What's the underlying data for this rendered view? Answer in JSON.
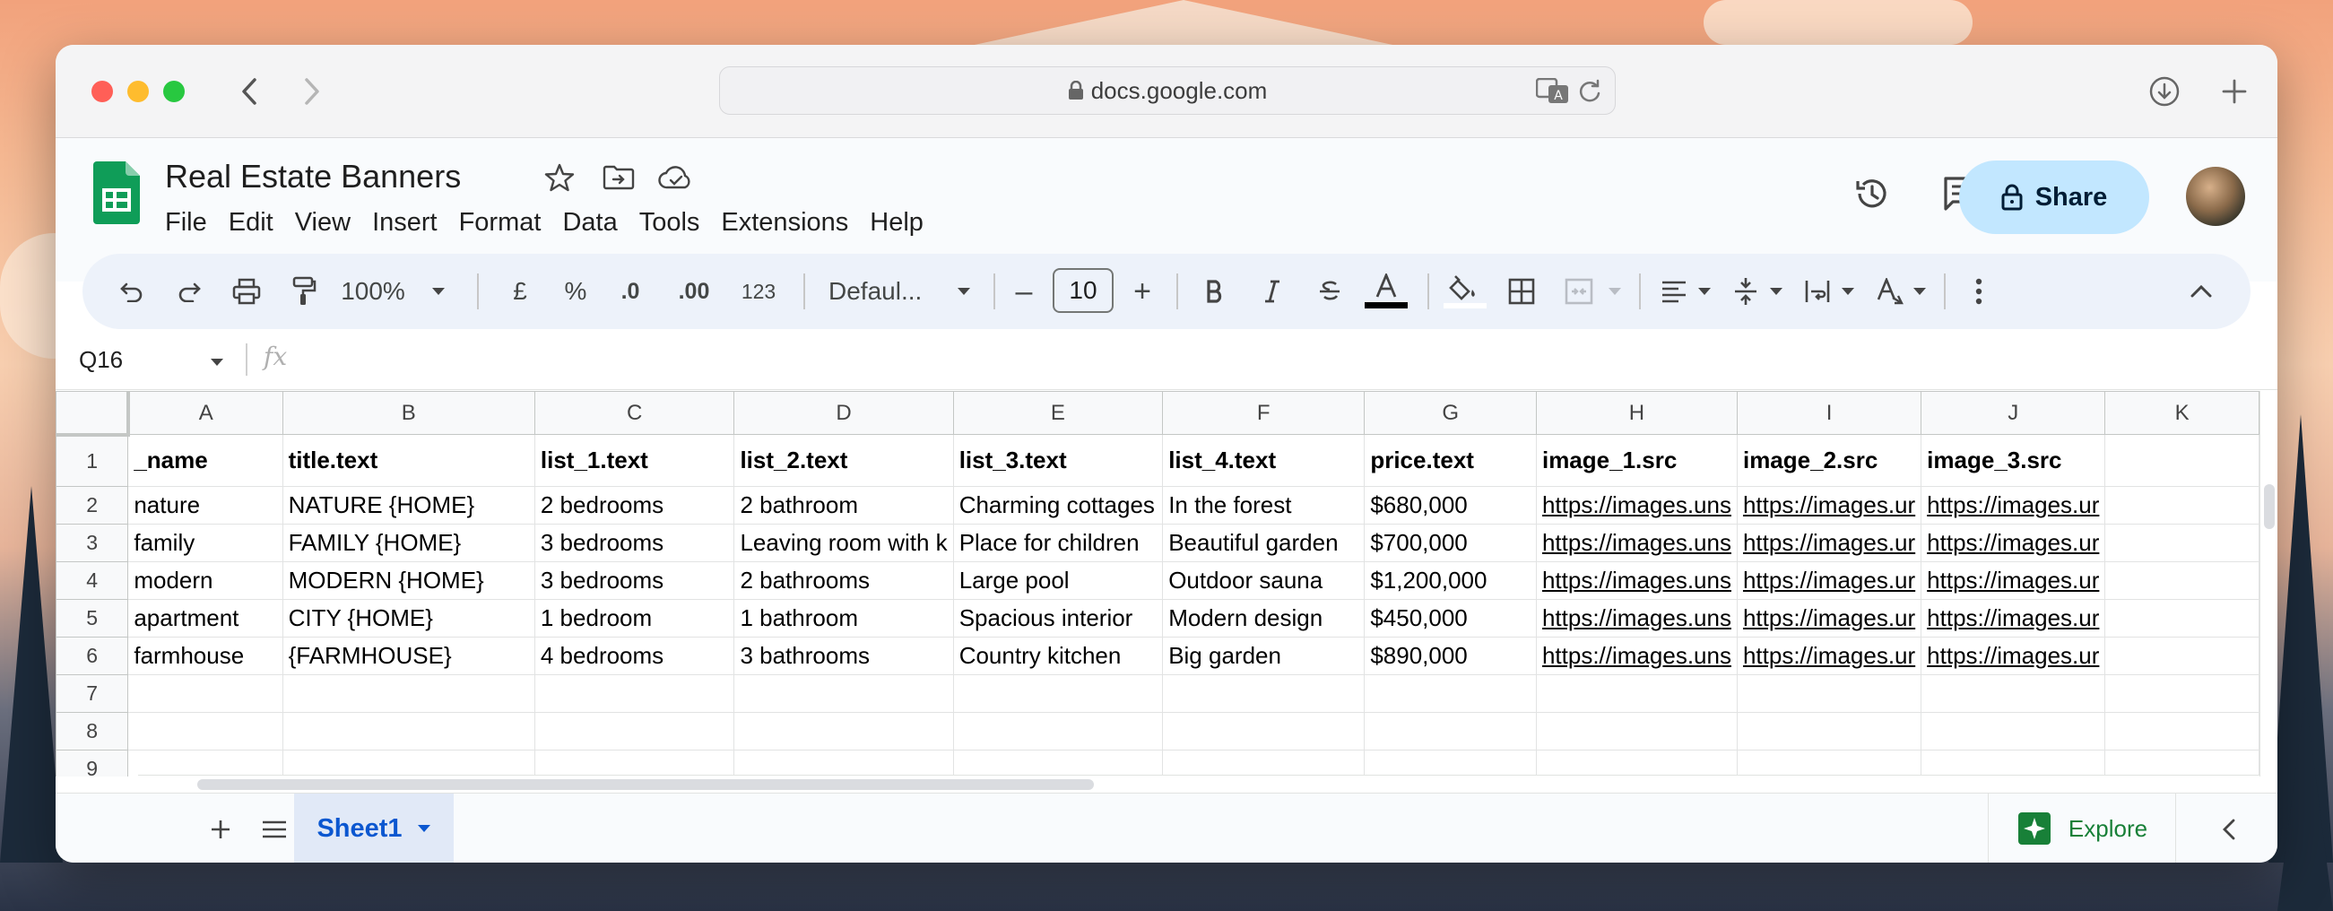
{
  "browser": {
    "url": "docs.google.com"
  },
  "doc": {
    "title": "Real Estate Banners",
    "menu": [
      "File",
      "Edit",
      "View",
      "Insert",
      "Format",
      "Data",
      "Tools",
      "Extensions",
      "Help"
    ],
    "share_label": "Share"
  },
  "toolbar": {
    "zoom": "100%",
    "currency": "£",
    "percent": "%",
    "dec_decrease": ".0",
    "dec_increase": ".00",
    "number_format": "123",
    "font": "Defaul...",
    "font_size": "10",
    "minus": "–",
    "plus": "+"
  },
  "formula_bar": {
    "cell_ref": "Q16",
    "fx": "fx",
    "value": ""
  },
  "sheet": {
    "columns": [
      "A",
      "B",
      "C",
      "D",
      "E",
      "F",
      "G",
      "H",
      "I",
      "J",
      "K"
    ],
    "row_numbers": [
      "1",
      "2",
      "3",
      "4",
      "5",
      "6",
      "7",
      "8",
      "9"
    ],
    "rows": [
      [
        "_name",
        "title.text",
        "list_1.text",
        "list_2.text",
        "list_3.text",
        "list_4.text",
        "price.text",
        "image_1.src",
        "image_2.src",
        "image_3.src",
        ""
      ],
      [
        "nature",
        "NATURE {HOME}",
        "2 bedrooms",
        "2 bathroom",
        "Charming cottages",
        "In the forest",
        "$680,000",
        "https://images.uns",
        "https://images.ur",
        "https://images.ur",
        ""
      ],
      [
        "family",
        "FAMILY {HOME}",
        "3 bedrooms",
        "Leaving room with k",
        "Place for children",
        "Beautiful garden",
        "$700,000",
        "https://images.uns",
        "https://images.ur",
        "https://images.ur",
        ""
      ],
      [
        "modern",
        "MODERN {HOME}",
        "3 bedrooms",
        "2 bathrooms",
        "Large pool",
        "Outdoor sauna",
        "$1,200,000",
        "https://images.uns",
        "https://images.ur",
        "https://images.ur",
        ""
      ],
      [
        "apartment",
        "CITY {HOME}",
        "1 bedroom",
        "1 bathroom",
        "Spacious interior",
        "Modern design",
        "$450,000",
        "https://images.uns",
        "https://images.ur",
        "https://images.ur",
        ""
      ],
      [
        "farmhouse",
        "{FARMHOUSE}",
        "4 bedrooms",
        "3 bathrooms",
        "Country kitchen",
        "Big garden",
        "$890,000",
        "https://images.uns",
        "https://images.ur",
        "https://images.ur",
        ""
      ],
      [
        "",
        "",
        "",
        "",
        "",
        "",
        "",
        "",
        "",
        "",
        ""
      ],
      [
        "",
        "",
        "",
        "",
        "",
        "",
        "",
        "",
        "",
        "",
        ""
      ],
      [
        "",
        "",
        "",
        "",
        "",
        "",
        "",
        "",
        "",
        "",
        ""
      ]
    ]
  },
  "tabs": {
    "sheet1": "Sheet1",
    "explore": "Explore"
  },
  "colors": {
    "accent": "#0b57d0",
    "share_bg": "#c2e7ff",
    "sheets_green": "#0f9d58",
    "link": "#1155cc"
  }
}
